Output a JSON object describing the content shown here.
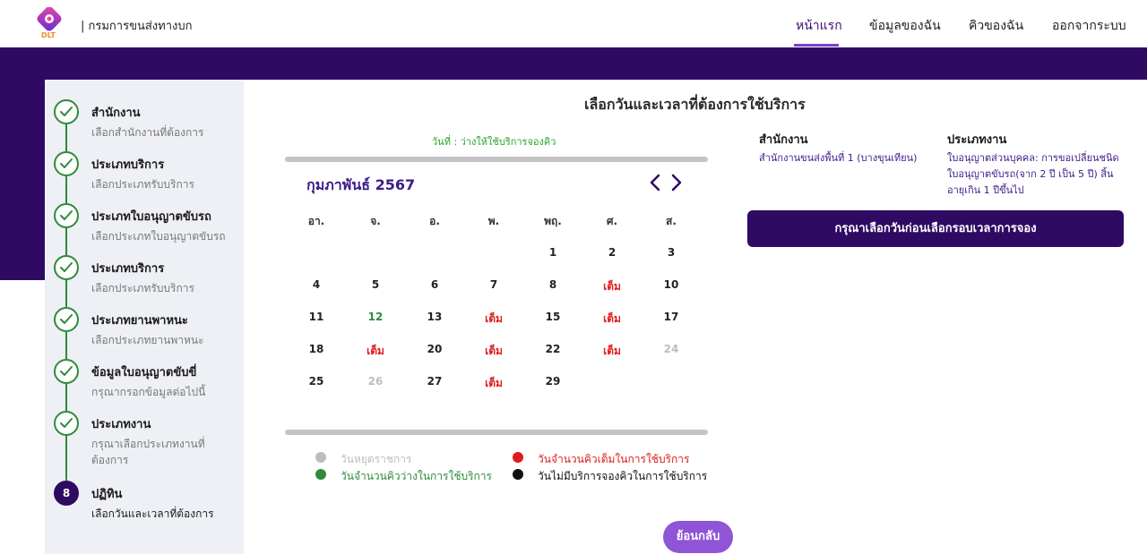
{
  "header": {
    "org_name": "| กรมการขนส่งทางบก",
    "logo_text": "DLT",
    "nav": [
      {
        "label": "หน้าแรก",
        "active": true
      },
      {
        "label": "ข้อมูลของฉัน",
        "active": false
      },
      {
        "label": "คิวของฉัน",
        "active": false
      },
      {
        "label": "ออกจากระบบ",
        "active": false
      }
    ]
  },
  "colors": {
    "brand": "#2e0a63",
    "accent": "#7b3fd1",
    "available": "#2e8b3a",
    "full": "#e01b1b",
    "holiday": "#bdbdbd",
    "back_button": "#8f55d6"
  },
  "steps": [
    {
      "title": "สำนักงาน",
      "subtitle": "เลือกสำนักงานที่ต้องการ",
      "status": "done"
    },
    {
      "title": "ประเภทบริการ",
      "subtitle": "เลือกประเภทรับบริการ",
      "status": "done"
    },
    {
      "title": "ประเภทใบอนุญาตขับรถ",
      "subtitle": "เลือกประเภทใบอนุญาตขับรถ",
      "status": "done"
    },
    {
      "title": "ประเภทบริการ",
      "subtitle": "เลือกประเภทรับบริการ",
      "status": "done"
    },
    {
      "title": "ประเภทยานพาหนะ",
      "subtitle": "เลือกประเภทยานพาหนะ",
      "status": "done"
    },
    {
      "title": "ข้อมูลใบอนุญาตขับขี่",
      "subtitle": "กรุณากรอกข้อมูลต่อไปนี้",
      "status": "done"
    },
    {
      "title": "ประเภทงาน",
      "subtitle": "กรุณาเลือกประเภทงานที่ต้องการ",
      "status": "done"
    },
    {
      "title": "ปฏิทิน",
      "subtitle": "เลือกวันและเวลาที่ต้องการ",
      "status": "current",
      "number": "8"
    }
  ],
  "main": {
    "title": "เลือกวันและเวลาที่ต้องการใช้บริการ",
    "availability_note": "วันที่ : ว่างให้ใช้บริการจองคิว",
    "calendar": {
      "month_label": "กุมภาพันธ์ 2567",
      "weekdays": [
        "อา.",
        "จ.",
        "อ.",
        "พ.",
        "พฤ.",
        "ศ.",
        "ส."
      ],
      "weeks": [
        [
          null,
          null,
          null,
          null,
          {
            "label": "1",
            "status": "normal"
          },
          {
            "label": "2",
            "status": "normal"
          },
          {
            "label": "3",
            "status": "normal"
          }
        ],
        [
          {
            "label": "4",
            "status": "normal"
          },
          {
            "label": "5",
            "status": "normal"
          },
          {
            "label": "6",
            "status": "normal"
          },
          {
            "label": "7",
            "status": "normal"
          },
          {
            "label": "8",
            "status": "normal"
          },
          {
            "label": "เต็ม",
            "status": "full"
          },
          {
            "label": "10",
            "status": "normal"
          }
        ],
        [
          {
            "label": "11",
            "status": "normal"
          },
          {
            "label": "12",
            "status": "avail"
          },
          {
            "label": "13",
            "status": "normal"
          },
          {
            "label": "เต็ม",
            "status": "full"
          },
          {
            "label": "15",
            "status": "normal"
          },
          {
            "label": "เต็ม",
            "status": "full"
          },
          {
            "label": "17",
            "status": "normal"
          }
        ],
        [
          {
            "label": "18",
            "status": "normal"
          },
          {
            "label": "เต็ม",
            "status": "full"
          },
          {
            "label": "20",
            "status": "normal"
          },
          {
            "label": "เต็ม",
            "status": "full"
          },
          {
            "label": "22",
            "status": "normal"
          },
          {
            "label": "เต็ม",
            "status": "full"
          },
          {
            "label": "24",
            "status": "holiday"
          }
        ],
        [
          {
            "label": "25",
            "status": "normal"
          },
          {
            "label": "26",
            "status": "holiday"
          },
          {
            "label": "27",
            "status": "normal"
          },
          {
            "label": "เต็ม",
            "status": "full"
          },
          {
            "label": "29",
            "status": "normal"
          },
          null,
          null
        ]
      ]
    },
    "legend": [
      {
        "label": "วันหยุดราชการ",
        "color": "#bdbdbd",
        "text_color": "#bdbdbd"
      },
      {
        "label": "วันจำนวนคิวเต็มในการใช้บริการ",
        "color": "#e01b1b",
        "text_color": "#e01b1b"
      },
      {
        "label": "วันจำนวนคิวว่างในการใช้บริการ",
        "color": "#2e8b3a",
        "text_color": "#2e8b3a"
      },
      {
        "label": "วันไม่มีบริการจองคิวในการใช้บริการ",
        "color": "#111111",
        "text_color": "#111111"
      }
    ],
    "info": {
      "office_label": "สำนักงาน",
      "office_value": "สำนักงานขนส่งพื้นที่ 1 (บางขุนเทียน)",
      "work_type_label": "ประเภทงาน",
      "work_type_value": "ใบอนุญาตส่วนบุคคล: การขอเปลี่ยนชนิดใบอนุญาตขับรถ(จาก 2 ปี เป็น 5 ปี) สิ้นอายุเกิน 1 ปีขึ้นไป"
    },
    "select_first_label": "กรุณาเลือกวันก่อนเลือกรอบเวลาการจอง",
    "back_label": "ย้อนกลับ"
  }
}
